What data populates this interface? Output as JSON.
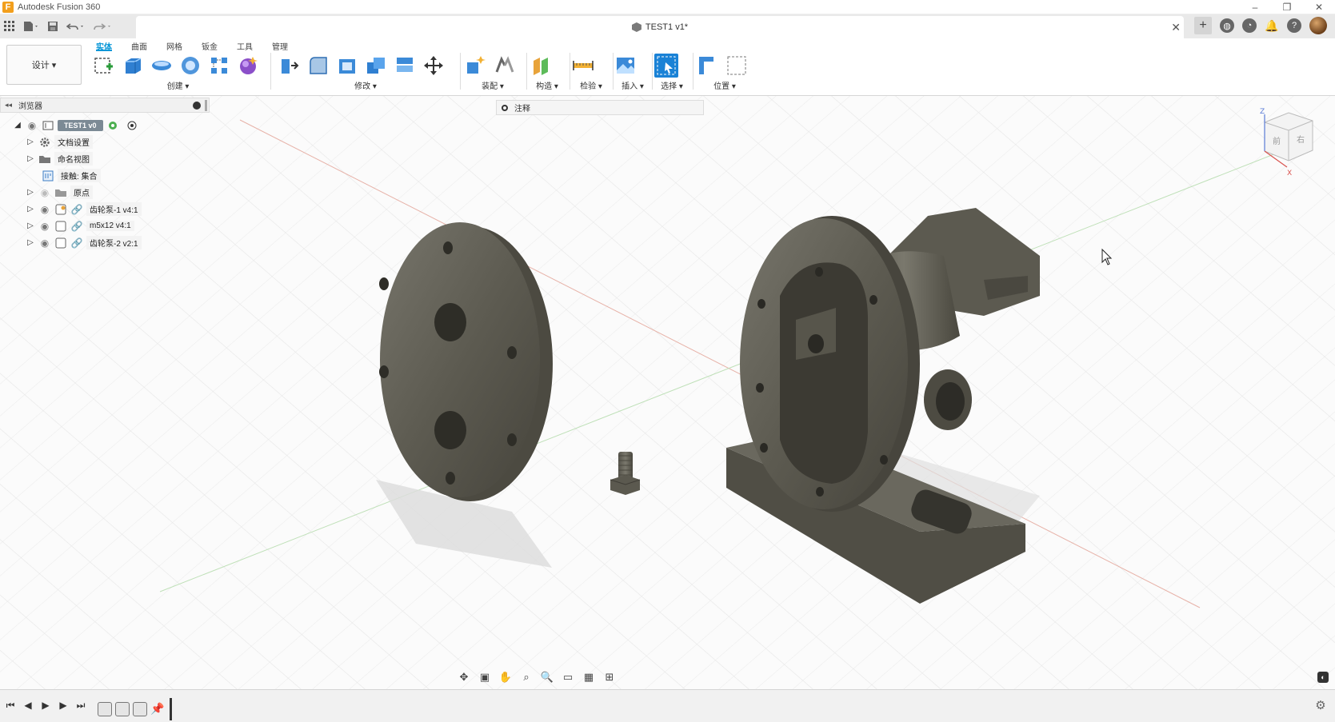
{
  "app": {
    "title": "Autodesk Fusion 360",
    "logo_letter": "F"
  },
  "window_controls": {
    "minimize": "–",
    "restore": "❐",
    "close": "✕"
  },
  "document": {
    "title": "TEST1 v1*",
    "close": "✕"
  },
  "ribbon": {
    "workspace": "设计 ▾",
    "tabs": [
      "实体",
      "曲面",
      "网格",
      "钣金",
      "工具",
      "管理"
    ],
    "active_tab": "实体",
    "groups": {
      "create": "创建 ▾",
      "modify": "修改 ▾",
      "assemble": "装配 ▾",
      "construct": "构造 ▾",
      "inspect": "检验 ▾",
      "insert": "插入 ▾",
      "select": "选择 ▾",
      "position": "位置 ▾"
    }
  },
  "browser": {
    "title": "浏览器",
    "root": "TEST1 v0",
    "items": [
      {
        "label": "文档设置"
      },
      {
        "label": "命名视图"
      },
      {
        "label": "接触: 集合"
      },
      {
        "label": "原点"
      },
      {
        "label": "齿轮泵-1 v4:1"
      },
      {
        "label": "m5x12 v4:1"
      },
      {
        "label": "齿轮泵-2 v2:1"
      }
    ]
  },
  "annotation": {
    "label": "注释"
  },
  "viewcube": {
    "front": "前",
    "right": "右",
    "axis_z": "Z",
    "axis_x": "X"
  },
  "colors": {
    "accent": "#0696d7",
    "model": "#5e5c52",
    "grid": "#e3e3e3"
  }
}
